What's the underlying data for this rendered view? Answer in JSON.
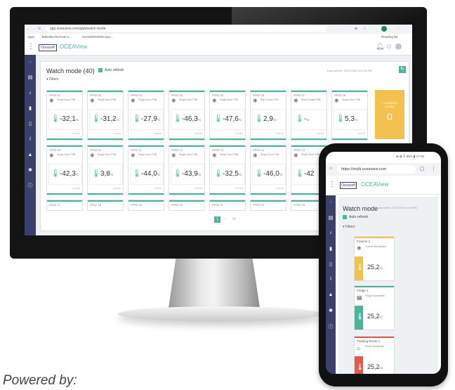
{
  "browser": {
    "url": "app.oceaview.com/app/watch-mode",
    "bookmarks": [
      "Apps",
      "Teltonika RUT240 s...",
      "OLIVIERIVERO.doc..."
    ],
    "reading_list": "Reading list"
  },
  "app": {
    "logo": "Oceasoft",
    "name": "OCEAView"
  },
  "watch": {
    "title": "Watch mode (40)",
    "auto_refresh": "Auto refresh",
    "last_refresh": "Last refresh: 20/07/2021 at 4:35 PM",
    "filters": "Filters"
  },
  "cards_row1": [
    {
      "name": "PFRZ 01",
      "type": "Single Door PSB",
      "value": "-32,1",
      "unit": "°C",
      "foot": "4:35 PM"
    },
    {
      "name": "PFRZ 02",
      "type": "Single Door PSB",
      "value": "-31,2",
      "unit": "°C",
      "foot": "4:35 PM"
    },
    {
      "name": "PFRZ 03",
      "type": "Single Door PSB",
      "value": "-27,9",
      "unit": "°C",
      "foot": "4:35 PM"
    },
    {
      "name": "PFRZ 04",
      "type": "Single Door PSB",
      "value": "-46,3",
      "unit": "°C",
      "foot": "4:35 PM"
    },
    {
      "name": "PFRZ 05",
      "type": "Single Door PSB",
      "value": "-47,6",
      "unit": "°C",
      "foot": "4:35 PM"
    },
    {
      "name": "PFRZ 06",
      "type": "Big 2 doors PSB",
      "value": "2,9",
      "unit": "°C",
      "foot": "4:35 PM"
    },
    {
      "name": "PFRZ 07",
      "type": "Small Single PSB",
      "value": "-",
      "unit": "°C",
      "foot": "4:35 PM"
    },
    {
      "name": "PFRZ 08",
      "type": "Single Door PSB",
      "value": "5,3",
      "unit": "°C",
      "foot": "4:35 PM"
    }
  ],
  "cards_row2": [
    {
      "name": "PFRZ 09",
      "type": "Single Door PSB",
      "value": "-42,3",
      "unit": "°C",
      "foot": "4:35 PM"
    },
    {
      "name": "PFRZ 10",
      "type": "Single Door PSB",
      "value": "3,8",
      "unit": "°C",
      "foot": "4:35 PM"
    },
    {
      "name": "PFRZ 11",
      "type": "Single Door PSB",
      "value": "-44,0",
      "unit": "°C",
      "foot": "4:35 PM"
    },
    {
      "name": "PFRZ 12",
      "type": "Single Door PSB",
      "value": "-43,9",
      "unit": "°C",
      "foot": "4:35 PM"
    },
    {
      "name": "PFRZ 13",
      "type": "Single Door PSB",
      "value": "-32,5",
      "unit": "°C",
      "foot": "4:35 PM"
    },
    {
      "name": "PFRZ 14",
      "type": "Single Door PSB",
      "value": "-46,0",
      "unit": "°C",
      "foot": "4:35 PM"
    },
    {
      "name": "PFRZ 15",
      "type": "Single Door PSB",
      "value": "-42",
      "unit": "",
      "foot": ""
    }
  ],
  "cards_row3": [
    "PFRZ 17",
    "PFRZ 18",
    "PFRZ 19",
    "PFRZ 20",
    "PFRZ 21",
    "PFRZ 22",
    "PFRZ 23"
  ],
  "alarm_card": {
    "label": "1 CURRENT ALARM",
    "count": "0"
  },
  "pagination": {
    "current": "1",
    "per_page": "16"
  },
  "phone": {
    "status": "⊕ ✿ ℤ 85% ▮ 17:49",
    "url": "https://multi.oceaview.com",
    "logo": "Oceasoft",
    "name": "OCEAView",
    "watch_title": "Watch mode",
    "last_refresh": "Last refresh: 20/07/2021 at 4:45 PM",
    "auto_refresh": "Auto refresh",
    "filters": "Filters",
    "cards": [
      {
        "name": "Freezer 1",
        "type": "Freezer Montpellier",
        "value": "25,2",
        "unit": "°C",
        "accent": "#f2c14e"
      },
      {
        "name": "Fridge 1",
        "type": "Fridge Montpellier",
        "value": "25,2",
        "unit": "°C",
        "accent": "#4bb59a"
      },
      {
        "name": "Training Room 1",
        "type": "Room Montpellier",
        "value": "25,2",
        "unit": "°C",
        "accent": "#e05a4f"
      }
    ]
  },
  "powered_by": "Powered by:",
  "colors": {
    "sidebar": "#3b3f6b",
    "accent": "#4bb59a",
    "alarm": "#f2c14e"
  }
}
